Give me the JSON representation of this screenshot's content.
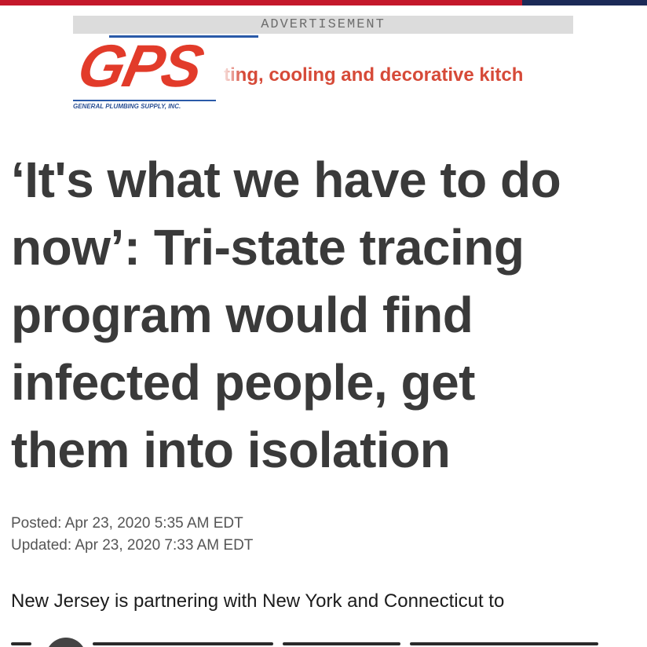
{
  "ad": {
    "header_label": "ADVERTISEMENT",
    "logo_text": "GPS",
    "logo_subtitle": "GENERAL PLUMBING SUPPLY, INC.",
    "tagline": "ting, cooling and decorative kitch"
  },
  "article": {
    "headline_lines": [
      "‘It's what we have to do",
      "now’: Tri-state tracing",
      "program would find",
      "infected people, get",
      "them into isolation"
    ],
    "posted": "Posted: Apr 23, 2020 5:35 AM EDT",
    "updated": "Updated: Apr 23, 2020 7:33 AM EDT",
    "body_first_line": "New Jersey is partnering with New York and Connecticut to"
  },
  "colors": {
    "top_bar_red": "#c4182b",
    "top_bar_navy": "#1b2a57",
    "logo_red": "#e23b2a",
    "logo_blue": "#2a5aa8",
    "headline_text": "#3a3a3a"
  }
}
